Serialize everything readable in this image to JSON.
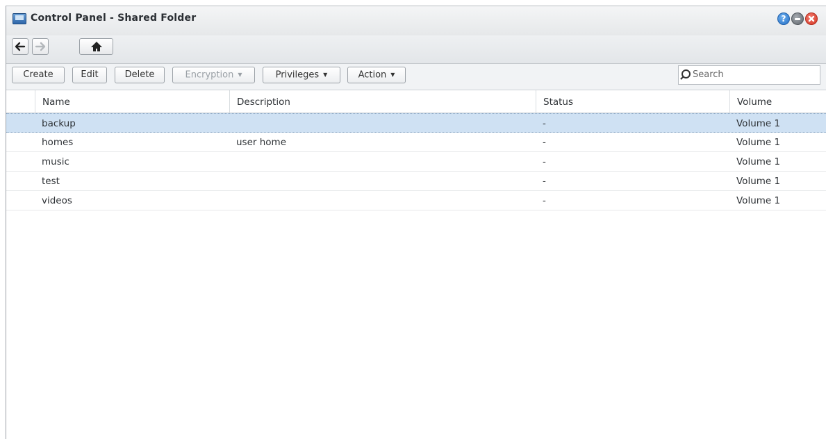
{
  "window": {
    "title": "Control Panel - Shared Folder"
  },
  "titlebar_buttons": {
    "help": "?"
  },
  "toolbar": {
    "create": "Create",
    "edit": "Edit",
    "delete": "Delete",
    "encryption": "Encryption",
    "privileges": "Privileges",
    "action": "Action"
  },
  "search": {
    "placeholder": "Search",
    "value": ""
  },
  "table": {
    "columns": [
      "Name",
      "Description",
      "Status",
      "Volume"
    ],
    "rows": [
      {
        "name": "backup",
        "description": "",
        "status": "-",
        "volume": "Volume 1",
        "selected": true
      },
      {
        "name": "homes",
        "description": "user home",
        "status": "-",
        "volume": "Volume 1",
        "selected": false
      },
      {
        "name": "music",
        "description": "",
        "status": "-",
        "volume": "Volume 1",
        "selected": false
      },
      {
        "name": "test",
        "description": "",
        "status": "-",
        "volume": "Volume 1",
        "selected": false
      },
      {
        "name": "videos",
        "description": "",
        "status": "-",
        "volume": "Volume 1",
        "selected": false
      }
    ]
  },
  "colors": {
    "selected_row": "#cfe1f3",
    "help_button": "#2570c6",
    "close_button": "#d33422"
  }
}
